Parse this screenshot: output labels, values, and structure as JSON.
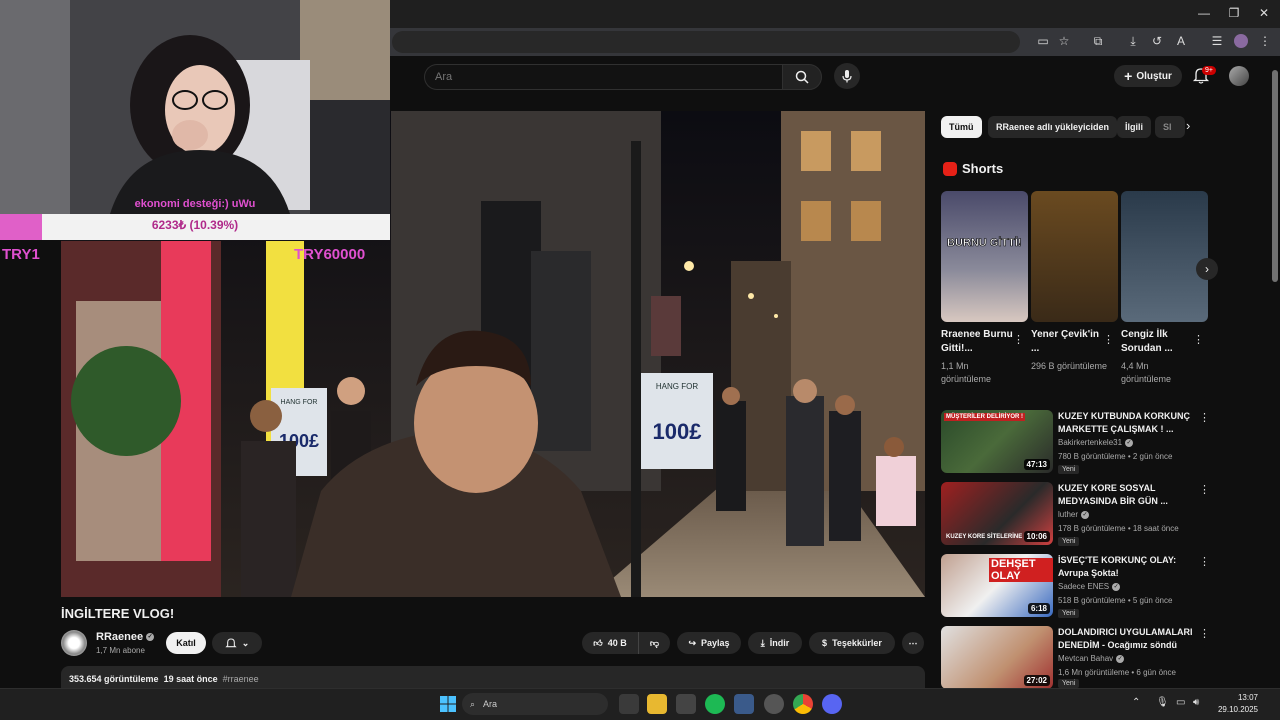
{
  "header": {
    "search_placeholder": "Ara",
    "create_label": "Oluştur",
    "notif_count": "9+"
  },
  "overlay": {
    "donation_caption": "ekonomi desteği:) uWu",
    "donation_text": "6233₺ (10.39%)",
    "donation_progress": 10.39,
    "try_left": "TRY1",
    "try_right": "TRY60000"
  },
  "video": {
    "title": "İNGİLTERE VLOG!",
    "sign_text": "HANG FOR",
    "sign_price": "100£"
  },
  "channel": {
    "name": "RRaenee",
    "subs": "1,7 Mn abone",
    "join_label": "Katıl"
  },
  "actions": {
    "likes": "40 B",
    "share": "Paylaş",
    "download": "İndir",
    "thanks": "Teşekkürler"
  },
  "description": {
    "views": "353.654 görüntüleme",
    "date": "19 saat önce",
    "tag": "#rraenee"
  },
  "chips": [
    "Tümü",
    "RRaenee adlı yükleyiciden",
    "İlgili",
    "Sl"
  ],
  "shorts": {
    "heading": "Shorts",
    "items": [
      {
        "title": "Rraenee Burnu Gitti!...",
        "views": "1,1 Mn görüntüleme",
        "overlay": "BURNU GİTTİ!"
      },
      {
        "title": "Yener Çevik'in ...",
        "views": "296 B görüntüleme"
      },
      {
        "title": "Cengiz İlk Sorudan ...",
        "views": "4,4 Mn görüntüleme"
      }
    ]
  },
  "recommendations": [
    {
      "title": "KUZEY KUTBUNDA KORKUNÇ MARKETTE ÇALIŞMAK ! ...",
      "channel": "Bakirkertenkele31",
      "meta": "780 B görüntüleme • 2 gün önce",
      "badge": "Yeni",
      "duration": "47:13",
      "thumb_text": "MÜŞTERİLER DELİRİYOR !"
    },
    {
      "title": "KUZEY KORE SOSYAL MEDYASINDA BİR GÜN ...",
      "channel": "luther",
      "meta": "178 B görüntüleme • 18 saat önce",
      "badge": "Yeni",
      "duration": "10:06",
      "thumb_text": "KUZEY KORE SİTELERİNE"
    },
    {
      "title": "İSVEÇ'TE KORKUNÇ OLAY: Avrupa Şokta!",
      "channel": "Sadece ENES",
      "meta": "518 B görüntüleme • 5 gün önce",
      "badge": "Yeni",
      "duration": "6:18",
      "thumb_text": "DEHŞET OLAY"
    },
    {
      "title": "DOLANDIRICI UYGULAMALARI DENEDİM - Ocağımız söndü",
      "channel": "Mevtcan Bahav",
      "meta": "1,6 Mn görüntüleme • 6 gün önce",
      "badge": "Yeni",
      "duration": "27:02",
      "thumb_text": ""
    }
  ],
  "taskbar": {
    "search_label": "Ara",
    "time": "13:07",
    "date": "29.10.2025"
  }
}
